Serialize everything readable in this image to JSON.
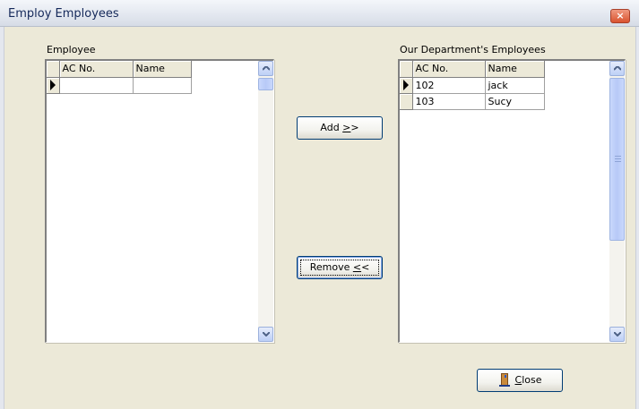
{
  "window": {
    "title": "Employ Employees",
    "close_glyph": "×"
  },
  "left_panel": {
    "label": "Employee",
    "columns": [
      "AC No.",
      "Name"
    ],
    "rows": [
      {
        "ac_no": "",
        "name": ""
      }
    ]
  },
  "right_panel": {
    "label": "Our Department's Employees",
    "columns": [
      "AC No.",
      "Name"
    ],
    "rows": [
      {
        "ac_no": "102",
        "name": "jack"
      },
      {
        "ac_no": "103",
        "name": "Sucy"
      }
    ]
  },
  "buttons": {
    "add": {
      "text": "Add ",
      "mnemonic": ">",
      "rest": ">"
    },
    "remove": {
      "text": "Remove ",
      "mnemonic": "<",
      "rest": "<"
    },
    "close": {
      "mnemonic": "C",
      "rest": "lose",
      "icon": "door-exit-icon"
    }
  },
  "colors": {
    "title_text": "#15295a",
    "dialog_bg": "#ece9d8",
    "button_border": "#003c74",
    "close_button": "#d9532f"
  }
}
